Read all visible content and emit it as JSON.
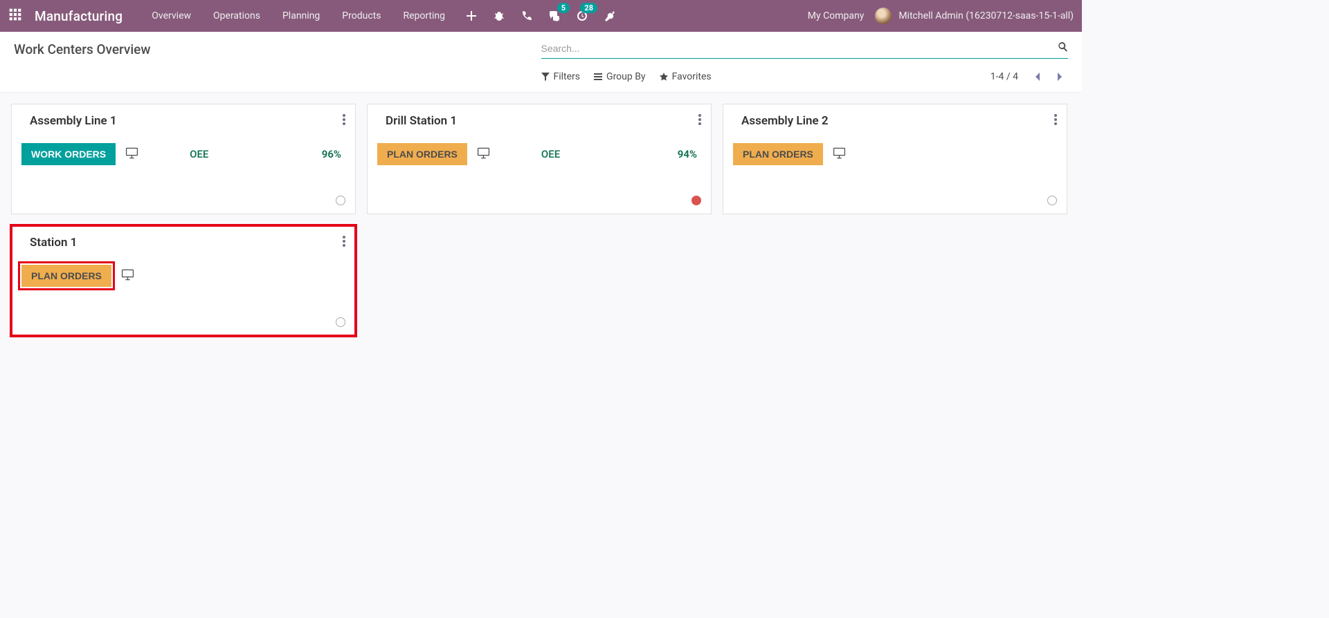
{
  "nav": {
    "brand": "Manufacturing",
    "links": [
      "Overview",
      "Operations",
      "Planning",
      "Products",
      "Reporting"
    ],
    "messages_badge": "5",
    "activities_badge": "28",
    "company": "My Company",
    "user": "Mitchell Admin (16230712-saas-15-1-all)"
  },
  "control": {
    "page_title": "Work Centers Overview",
    "search_placeholder": "Search...",
    "filters_label": "Filters",
    "groupby_label": "Group By",
    "favorites_label": "Favorites",
    "pager": "1-4 / 4"
  },
  "buttons": {
    "work_orders": "WORK ORDERS",
    "plan_orders": "PLAN ORDERS",
    "oee": "OEE"
  },
  "cards": [
    {
      "title": "Assembly Line 1",
      "button_type": "work",
      "oee": "96%",
      "status": "idle",
      "highlight": false
    },
    {
      "title": "Drill Station 1",
      "button_type": "plan",
      "oee": "94%",
      "status": "red",
      "highlight": false
    },
    {
      "title": "Assembly Line 2",
      "button_type": "plan",
      "oee": null,
      "status": "idle",
      "highlight": false
    },
    {
      "title": "Station 1",
      "button_type": "plan",
      "oee": null,
      "status": "idle",
      "highlight": true
    }
  ]
}
